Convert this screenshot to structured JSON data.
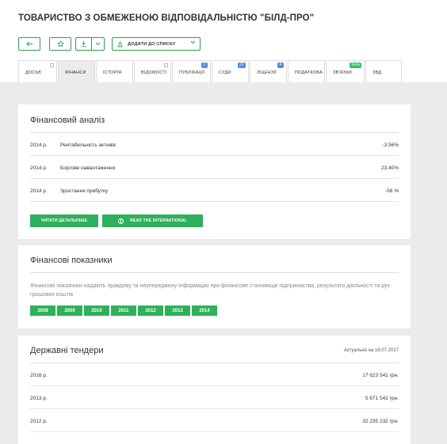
{
  "header": {
    "company_title": "ТОВАРИСТВО З ОБМЕЖЕНОЮ ВІДПОВІДАЛЬНІСТЮ \"БІЛД-ПРО\"",
    "add_to_list": "ДОДАТИ ДО СПИСКУ"
  },
  "tabs": [
    {
      "label": "ДОСЬЄ",
      "active": false,
      "badge": null
    },
    {
      "label": "ФІНАНСИ",
      "active": true,
      "badge": null
    },
    {
      "label": "ІСТОРІЯ",
      "active": false,
      "badge": null
    },
    {
      "label": "ВІДОМОСТІ",
      "active": false,
      "badge": null
    },
    {
      "label": "ПУБЛІКАЦІЇ",
      "active": false,
      "badge": "2"
    },
    {
      "label": "СУДИ",
      "active": false,
      "badge": "22"
    },
    {
      "label": "ЛІЦЕНЗІЇ",
      "active": false,
      "badge": "4"
    },
    {
      "label": "ПОДАТКОВА",
      "active": false,
      "badge": null
    },
    {
      "label": "ЗВ'ЯЗКИ",
      "active": false,
      "badge": "beta"
    },
    {
      "label": "ЗВД",
      "active": false,
      "badge": null
    }
  ],
  "financial_analysis": {
    "title": "Фінансовий аналіз",
    "rows": [
      {
        "year": "2014 р.",
        "label": "Рентабельність активів",
        "value": "-3.56%"
      },
      {
        "year": "2014 р.",
        "label": "Боргове навантаження",
        "value": "23.40%"
      },
      {
        "year": "2014 р.",
        "label": "Зростання прибутку",
        "value": "-56 %"
      }
    ],
    "read_more": "ЧИТАТИ ДЕТАЛЬНІШЕ",
    "read_international": "READ THE INTERNATIONAL"
  },
  "financial_indicators": {
    "title": "Фінансові показники",
    "description": "Фінансові показники надають правдиву та неупереджену інформацію про фінансове становище підприємства, результати діяльності та рух грошових коштів",
    "years": [
      "2008",
      "2009",
      "2010",
      "2011",
      "2012",
      "2013",
      "2014"
    ]
  },
  "tenders": {
    "title": "Державні тендери",
    "updated": "Актуально на 16.07.2017",
    "rows": [
      {
        "year": "2016 р.",
        "value": "17 623 541 грн."
      },
      {
        "year": "2013 р.",
        "value": "5 671 542 грн."
      },
      {
        "year": "2012 р.",
        "value": "32 235 232 грн."
      }
    ]
  },
  "colors": {
    "accent": "#2fb05b",
    "outline": "#2e9e4f",
    "background": "#ebebeb"
  }
}
